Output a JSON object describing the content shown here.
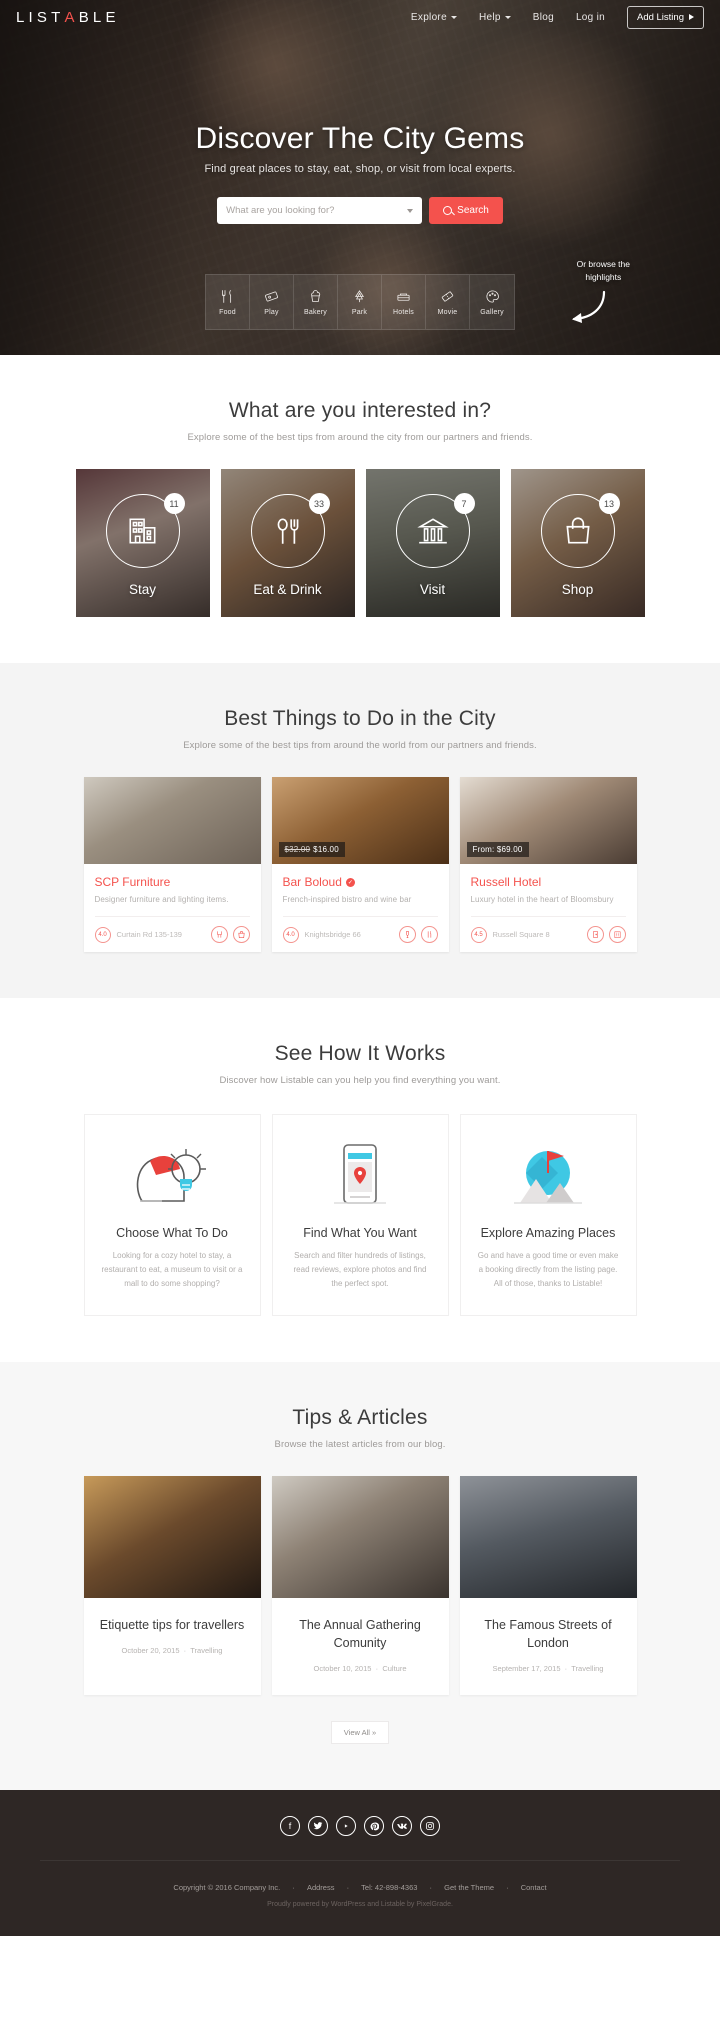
{
  "brand": {
    "name": "LISTABLE",
    "accent_letter": "A",
    "accent_color": "#f4524d"
  },
  "nav": {
    "items": [
      {
        "label": "Explore",
        "has_dropdown": true
      },
      {
        "label": "Help",
        "has_dropdown": true
      },
      {
        "label": "Blog",
        "has_dropdown": false
      },
      {
        "label": "Log in",
        "has_dropdown": false
      }
    ],
    "cta": {
      "label": "Add Listing",
      "icon": "caret-right-icon"
    }
  },
  "hero": {
    "title": "Discover The City Gems",
    "subtitle": "Find great places to stay, eat, shop, or visit from local experts.",
    "search": {
      "placeholder": "What are you looking for?",
      "value": "",
      "button_label": "Search",
      "button_icon": "search-icon",
      "dropdown_icon": "chevron-down-icon"
    },
    "browse_hint_line1": "Or browse the",
    "browse_hint_line2": "highlights",
    "categories": [
      {
        "label": "Food",
        "icon": "fork-knife-icon"
      },
      {
        "label": "Play",
        "icon": "ticket-icon"
      },
      {
        "label": "Bakery",
        "icon": "cupcake-icon"
      },
      {
        "label": "Park",
        "icon": "tree-icon"
      },
      {
        "label": "Hotels",
        "icon": "bed-icon"
      },
      {
        "label": "Movie",
        "icon": "film-ticket-icon"
      },
      {
        "label": "Gallery",
        "icon": "palette-icon"
      }
    ]
  },
  "interests": {
    "title": "What are you interested in?",
    "subtitle": "Explore some of the best tips from around the city from our partners and friends.",
    "items": [
      {
        "label": "Stay",
        "count": "11",
        "icon": "building-icon"
      },
      {
        "label": "Eat & Drink",
        "count": "33",
        "icon": "spoon-fork-icon"
      },
      {
        "label": "Visit",
        "count": "7",
        "icon": "museum-icon"
      },
      {
        "label": "Shop",
        "count": "13",
        "icon": "handbag-icon"
      }
    ]
  },
  "things": {
    "title": "Best Things to Do in the City",
    "subtitle": "Explore some of the best tips from around the world from our partners and friends.",
    "cards": [
      {
        "title": "SCP Furniture",
        "verified": false,
        "description": "Designer furniture and lighting items.",
        "rating": "4.0",
        "address": "Curtain Rd 135-139",
        "price_old": "",
        "price_new": "",
        "price_prefix": "",
        "icons": [
          "chair-icon",
          "bag-icon"
        ]
      },
      {
        "title": "Bar Boloud",
        "verified": true,
        "description": "French-inspired bistro and wine bar",
        "rating": "4.0",
        "address": "Knightsbridge 66",
        "price_old": "$32.00",
        "price_new": "$16.00",
        "price_prefix": "",
        "icons": [
          "wine-icon",
          "cutlery-icon"
        ]
      },
      {
        "title": "Russell Hotel",
        "verified": false,
        "description": "Luxury hotel in the heart of Bloomsbury",
        "rating": "4.5",
        "address": "Russell Square 8",
        "price_old": "",
        "price_new": "$69.00",
        "price_prefix": "From:",
        "icons": [
          "door-icon",
          "hotel-icon"
        ]
      }
    ]
  },
  "how": {
    "title": "See How It Works",
    "subtitle": "Discover how Listable can you help you find everything you want.",
    "steps": [
      {
        "title": "Choose What To Do",
        "text": "Looking for a cozy hotel to stay, a restaurant to eat, a museum to visit or a mall to do some shopping?",
        "icon": "head-lightbulb-icon"
      },
      {
        "title": "Find What You Want",
        "text": "Search and filter hundreds of listings, read reviews, explore photos and find the perfect spot.",
        "icon": "phone-map-pin-icon"
      },
      {
        "title": "Explore Amazing Places",
        "text": "Go and have a good time or even make a booking directly from the listing page. All of those, thanks to Listable!",
        "icon": "globe-flag-icon"
      }
    ]
  },
  "articles": {
    "title": "Tips & Articles",
    "subtitle": "Browse the latest articles from our blog.",
    "items": [
      {
        "title": "Etiquette tips for travellers",
        "date": "October 20, 2015",
        "category": "Travelling"
      },
      {
        "title": "The Annual Gathering Comunity",
        "date": "October 10, 2015",
        "category": "Culture"
      },
      {
        "title": "The Famous Streets of London",
        "date": "September 17, 2015",
        "category": "Travelling"
      }
    ],
    "view_all_label": "View All"
  },
  "footer": {
    "socials": [
      {
        "name": "facebook-icon",
        "glyph": "f"
      },
      {
        "name": "twitter-icon",
        "glyph": "ᵛ"
      },
      {
        "name": "youtube-icon",
        "glyph": "▸"
      },
      {
        "name": "pinterest-icon",
        "glyph": "P"
      },
      {
        "name": "vk-icon",
        "glyph": "В"
      },
      {
        "name": "instagram-icon",
        "glyph": "▣"
      }
    ],
    "links": [
      "Copyright © 2016 Company Inc.",
      "Address",
      "Tel: 42-898-4363",
      "Get the Theme",
      "Contact"
    ],
    "credit": "Proudly powered by WordPress and Listable by PixelGrade."
  }
}
